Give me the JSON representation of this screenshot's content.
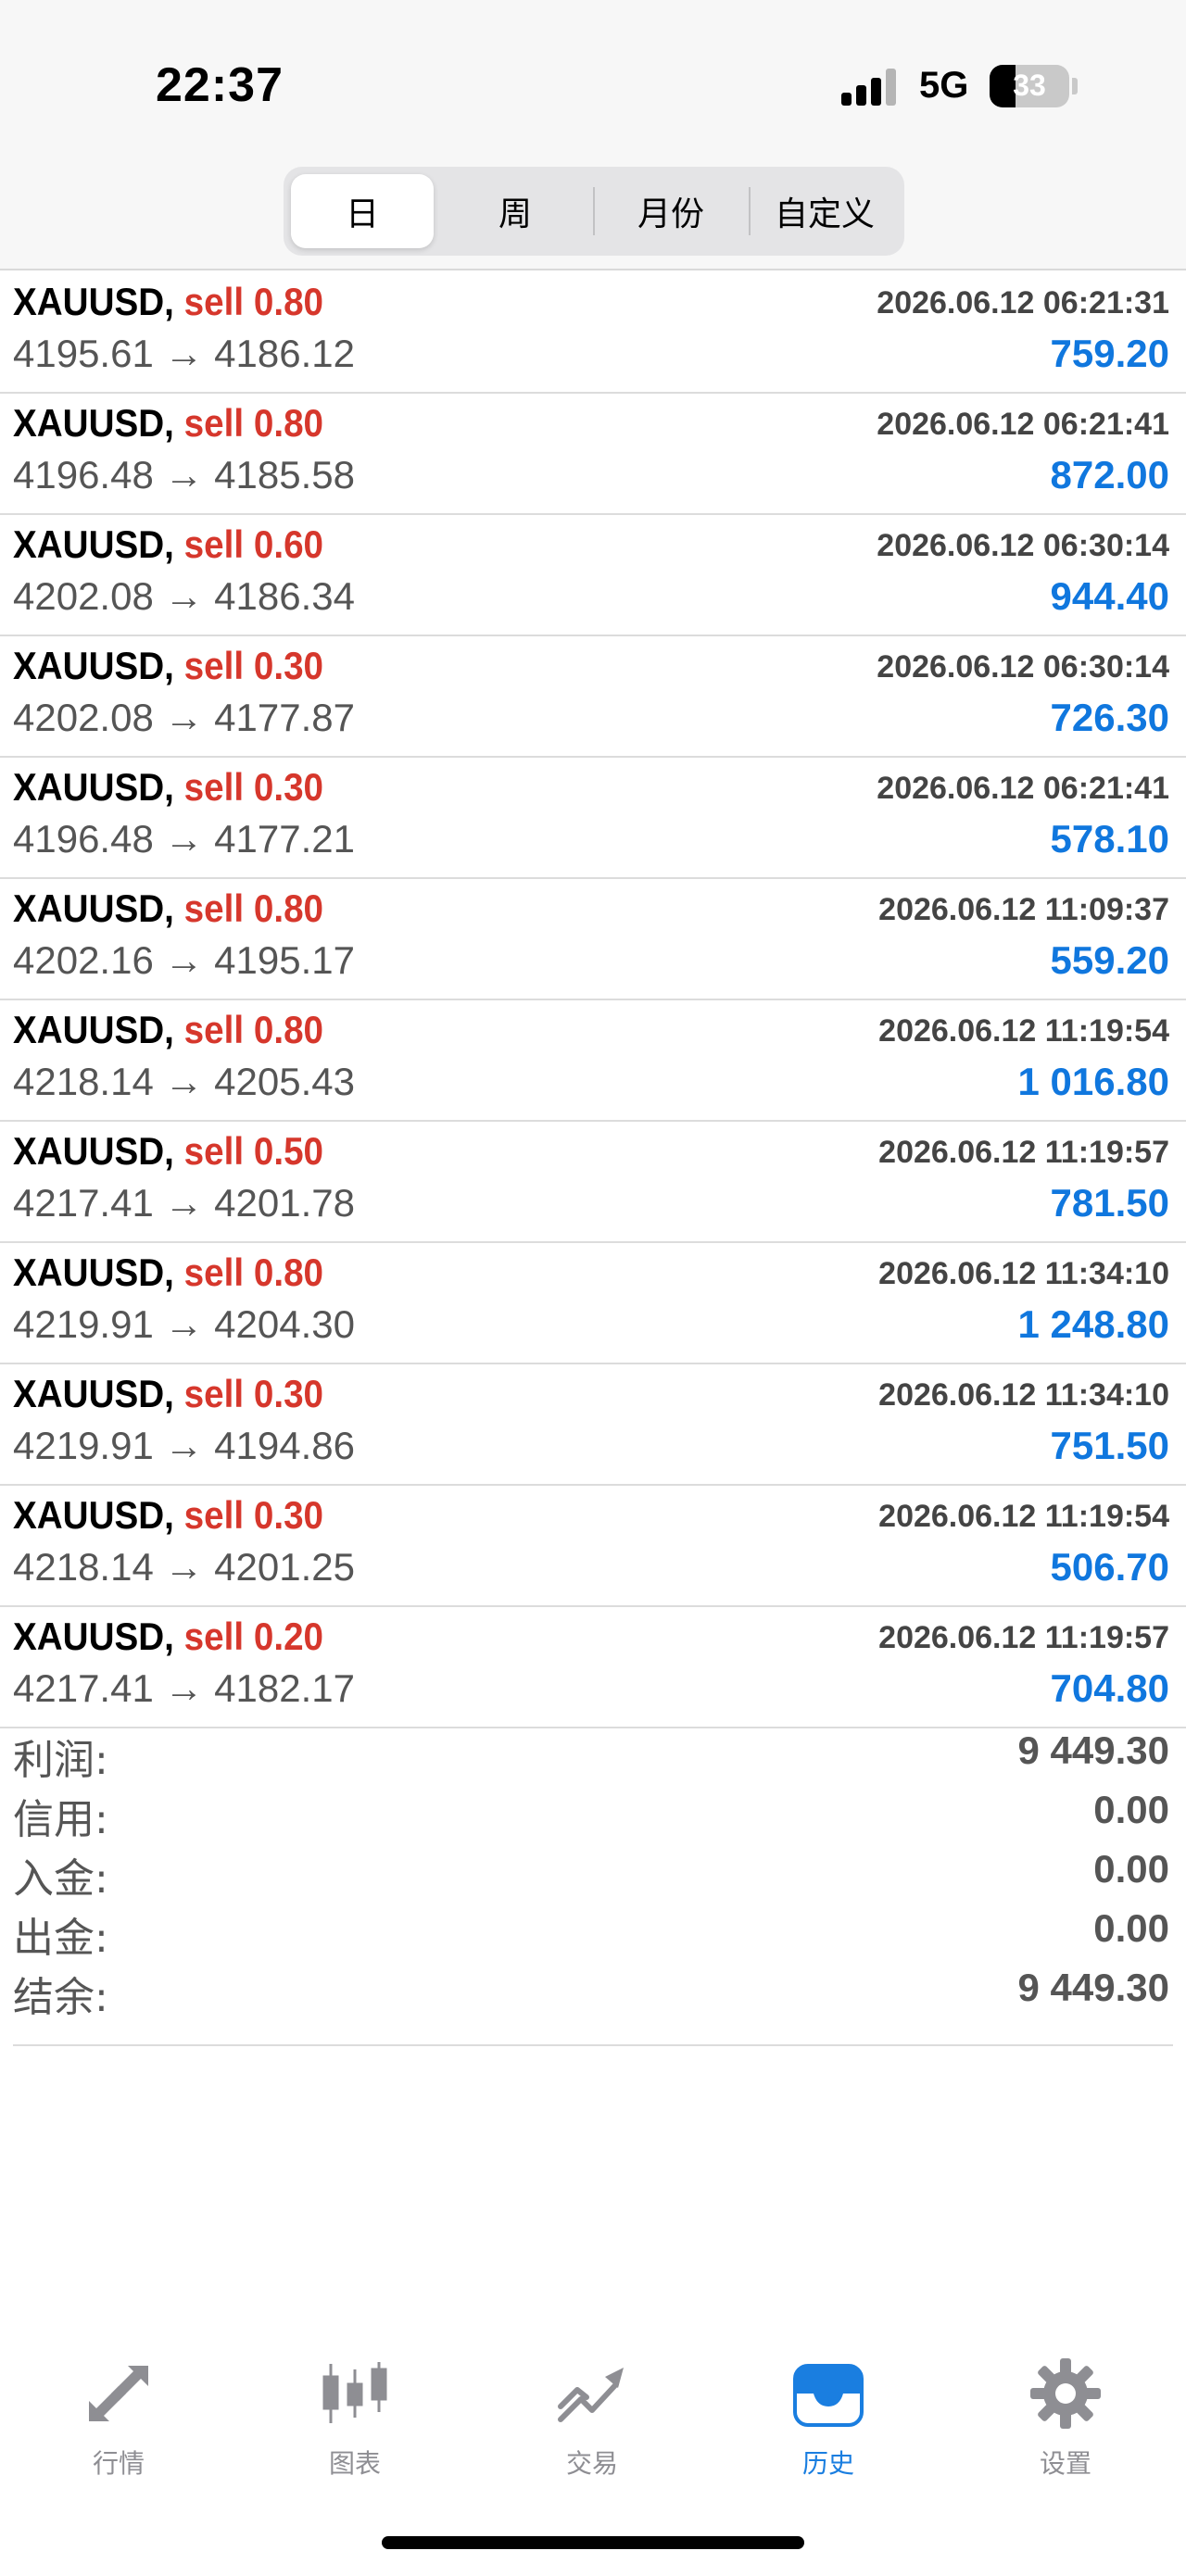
{
  "status_bar": {
    "time": "22:37",
    "network": "5G",
    "battery": "33",
    "battery_level_percent": 33
  },
  "period_tabs": [
    {
      "label": "日",
      "active": true
    },
    {
      "label": "周",
      "active": false
    },
    {
      "label": "月份",
      "active": false
    },
    {
      "label": "自定义",
      "active": false
    }
  ],
  "deals": [
    {
      "symbol": "XAUUSD,",
      "type": "sell",
      "volume": "0.80",
      "time": "2026.06.12 06:21:31",
      "open": "4195.61",
      "close": "4186.12",
      "profit": "759.20"
    },
    {
      "symbol": "XAUUSD,",
      "type": "sell",
      "volume": "0.80",
      "time": "2026.06.12 06:21:41",
      "open": "4196.48",
      "close": "4185.58",
      "profit": "872.00"
    },
    {
      "symbol": "XAUUSD,",
      "type": "sell",
      "volume": "0.60",
      "time": "2026.06.12 06:30:14",
      "open": "4202.08",
      "close": "4186.34",
      "profit": "944.40"
    },
    {
      "symbol": "XAUUSD,",
      "type": "sell",
      "volume": "0.30",
      "time": "2026.06.12 06:30:14",
      "open": "4202.08",
      "close": "4177.87",
      "profit": "726.30"
    },
    {
      "symbol": "XAUUSD,",
      "type": "sell",
      "volume": "0.30",
      "time": "2026.06.12 06:21:41",
      "open": "4196.48",
      "close": "4177.21",
      "profit": "578.10"
    },
    {
      "symbol": "XAUUSD,",
      "type": "sell",
      "volume": "0.80",
      "time": "2026.06.12 11:09:37",
      "open": "4202.16",
      "close": "4195.17",
      "profit": "559.20"
    },
    {
      "symbol": "XAUUSD,",
      "type": "sell",
      "volume": "0.80",
      "time": "2026.06.12 11:19:54",
      "open": "4218.14",
      "close": "4205.43",
      "profit": "1 016.80"
    },
    {
      "symbol": "XAUUSD,",
      "type": "sell",
      "volume": "0.50",
      "time": "2026.06.12 11:19:57",
      "open": "4217.41",
      "close": "4201.78",
      "profit": "781.50"
    },
    {
      "symbol": "XAUUSD,",
      "type": "sell",
      "volume": "0.80",
      "time": "2026.06.12 11:34:10",
      "open": "4219.91",
      "close": "4204.30",
      "profit": "1 248.80"
    },
    {
      "symbol": "XAUUSD,",
      "type": "sell",
      "volume": "0.30",
      "time": "2026.06.12 11:34:10",
      "open": "4219.91",
      "close": "4194.86",
      "profit": "751.50"
    },
    {
      "symbol": "XAUUSD,",
      "type": "sell",
      "volume": "0.30",
      "time": "2026.06.12 11:19:54",
      "open": "4218.14",
      "close": "4201.25",
      "profit": "506.70"
    },
    {
      "symbol": "XAUUSD,",
      "type": "sell",
      "volume": "0.20",
      "time": "2026.06.12 11:19:57",
      "open": "4217.41",
      "close": "4182.17",
      "profit": "704.80"
    }
  ],
  "summary": [
    {
      "label": "利润:",
      "value": "9 449.30"
    },
    {
      "label": "信用:",
      "value": "0.00"
    },
    {
      "label": "入金:",
      "value": "0.00"
    },
    {
      "label": "出金:",
      "value": "0.00"
    },
    {
      "label": "结余:",
      "value": "9 449.30"
    }
  ],
  "bottom_nav": [
    {
      "label": "行情",
      "icon": "quotes-arrows-icon",
      "active": false
    },
    {
      "label": "图表",
      "icon": "candlestick-chart-icon",
      "active": false
    },
    {
      "label": "交易",
      "icon": "trade-trend-icon",
      "active": false
    },
    {
      "label": "历史",
      "icon": "history-inbox-icon",
      "active": true
    },
    {
      "label": "设置",
      "icon": "gear-icon",
      "active": false
    }
  ],
  "colors": {
    "sell": "#d6372c",
    "profit": "#1077de",
    "nav_active": "#1a7ee0",
    "nav_inactive": "#8e8e93"
  }
}
